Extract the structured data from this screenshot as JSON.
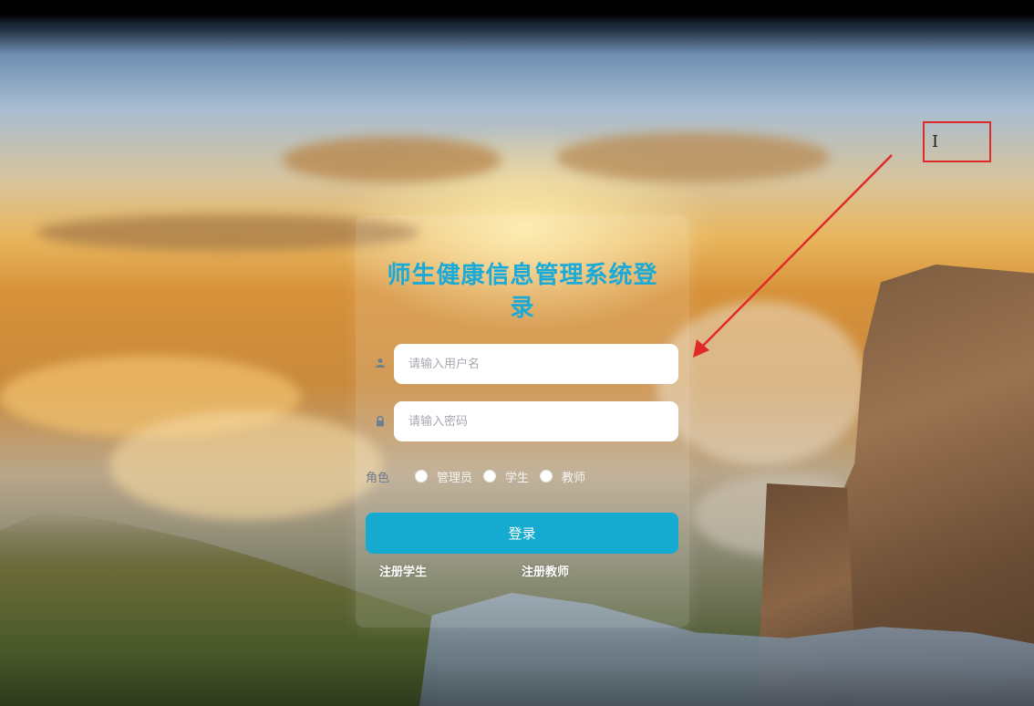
{
  "login": {
    "title": "师生健康信息管理系统登录",
    "username_placeholder": "请输入用户名",
    "password_placeholder": "请输入密码",
    "role_label": "角色",
    "roles": [
      "管理员",
      "学生",
      "教师"
    ],
    "submit_label": "登录",
    "register_student": "注册学生",
    "register_teacher": "注册教师"
  },
  "colors": {
    "title": "#19aad8",
    "button": "#15aacf",
    "annotation": "#e02a2a"
  },
  "icons": {
    "username": "user-icon",
    "password": "lock-icon",
    "cursor": "text-cursor-icon"
  }
}
